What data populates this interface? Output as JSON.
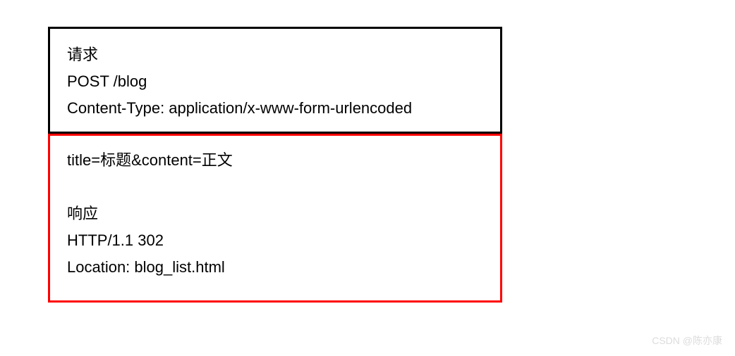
{
  "request_box": {
    "line1": "请求",
    "line2": "POST /blog",
    "line3": "Content-Type: application/x-www-form-urlencoded"
  },
  "response_box": {
    "line1": "title=标题&content=正文",
    "line2": "响应",
    "line3": "HTTP/1.1 302",
    "line4": "Location: blog_list.html"
  },
  "watermark": "CSDN @陈亦康"
}
